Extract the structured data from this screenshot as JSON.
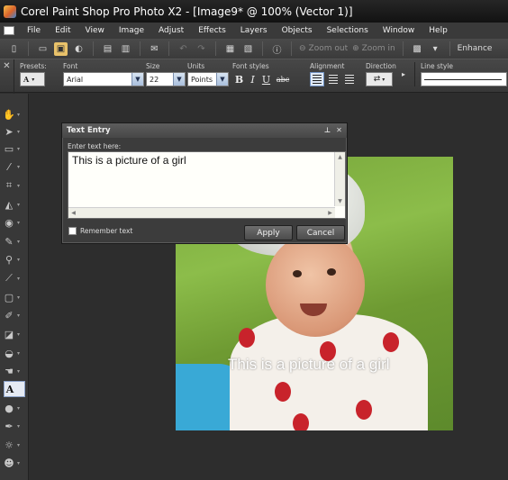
{
  "window": {
    "title": "Corel Paint Shop Pro Photo X2 - [Image9* @ 100% (Vector 1)]"
  },
  "menu": [
    "File",
    "Edit",
    "View",
    "Image",
    "Adjust",
    "Effects",
    "Layers",
    "Objects",
    "Selections",
    "Window",
    "Help"
  ],
  "toolbar": {
    "zoom_out": "Zoom out",
    "zoom_in": "Zoom in",
    "enhance": "Enhance"
  },
  "options": {
    "presets_label": "Presets:",
    "font_label": "Font",
    "font_value": "Arial",
    "size_label": "Size",
    "size_value": "22",
    "units_label": "Units",
    "units_value": "Points",
    "font_styles_label": "Font styles",
    "bold": "B",
    "italic": "I",
    "underline": "U",
    "strikethrough": "abc",
    "alignment_label": "Alignment",
    "direction_label": "Direction",
    "line_style_label": "Line style"
  },
  "tools": [
    {
      "icon": "pan-icon",
      "glyph": "✋"
    },
    {
      "icon": "pick-icon",
      "glyph": "➤"
    },
    {
      "icon": "selection-icon",
      "glyph": "▭"
    },
    {
      "icon": "dropper-icon",
      "glyph": "⁄"
    },
    {
      "icon": "crop-icon",
      "glyph": "⌗"
    },
    {
      "icon": "straighten-icon",
      "glyph": "◭"
    },
    {
      "icon": "red-eye-icon",
      "glyph": "◉"
    },
    {
      "icon": "makeover-icon",
      "glyph": "✎"
    },
    {
      "icon": "clone-icon",
      "glyph": "⚲"
    },
    {
      "icon": "scratch-remover-icon",
      "glyph": "⟋"
    },
    {
      "icon": "eraser-icon",
      "glyph": "▢"
    },
    {
      "icon": "paint-brush-icon",
      "glyph": "✐"
    },
    {
      "icon": "color-replacer-icon",
      "glyph": "◪"
    },
    {
      "icon": "fill-icon",
      "glyph": "◒"
    },
    {
      "icon": "smudge-icon",
      "glyph": "☚"
    },
    {
      "icon": "text-icon",
      "glyph": "A"
    },
    {
      "icon": "shape-icon",
      "glyph": "●"
    },
    {
      "icon": "pen-icon",
      "glyph": "✒"
    },
    {
      "icon": "warp-icon",
      "glyph": "☼"
    },
    {
      "icon": "retouch-icon",
      "glyph": "☻"
    }
  ],
  "dialog": {
    "title": "Text Entry",
    "label": "Enter text here:",
    "text": "This is a picture of a girl",
    "remember": "Remember text",
    "apply": "Apply",
    "cancel": "Cancel"
  },
  "canvas": {
    "overlay_text": "This is a picture of a girl"
  }
}
